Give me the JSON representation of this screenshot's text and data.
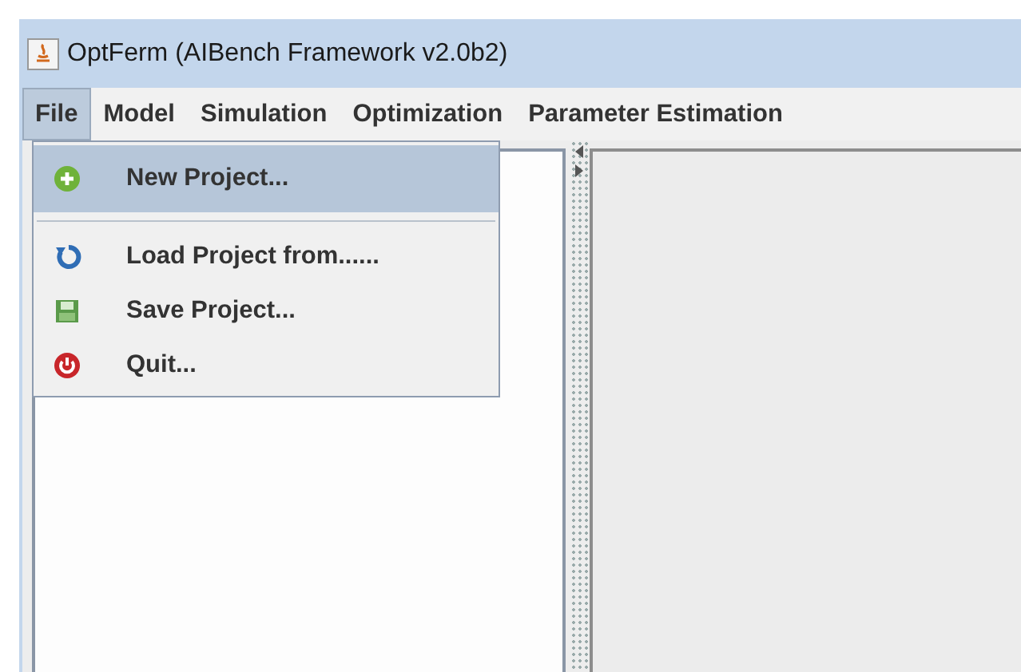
{
  "window": {
    "title": "OptFerm (AIBench Framework v2.0b2)"
  },
  "menubar": [
    {
      "label": "File",
      "selected": true
    },
    {
      "label": "Model",
      "selected": false
    },
    {
      "label": "Simulation",
      "selected": false
    },
    {
      "label": "Optimization",
      "selected": false
    },
    {
      "label": "Parameter Estimation",
      "selected": false
    }
  ],
  "file_menu": [
    {
      "kind": "item",
      "label": "New Project...",
      "selected": true
    },
    {
      "kind": "separator"
    },
    {
      "kind": "item",
      "label": "Load Project from......",
      "selected": false
    },
    {
      "kind": "item",
      "label": "Save Project...",
      "selected": false
    },
    {
      "kind": "item",
      "label": "Quit...",
      "selected": false
    }
  ]
}
